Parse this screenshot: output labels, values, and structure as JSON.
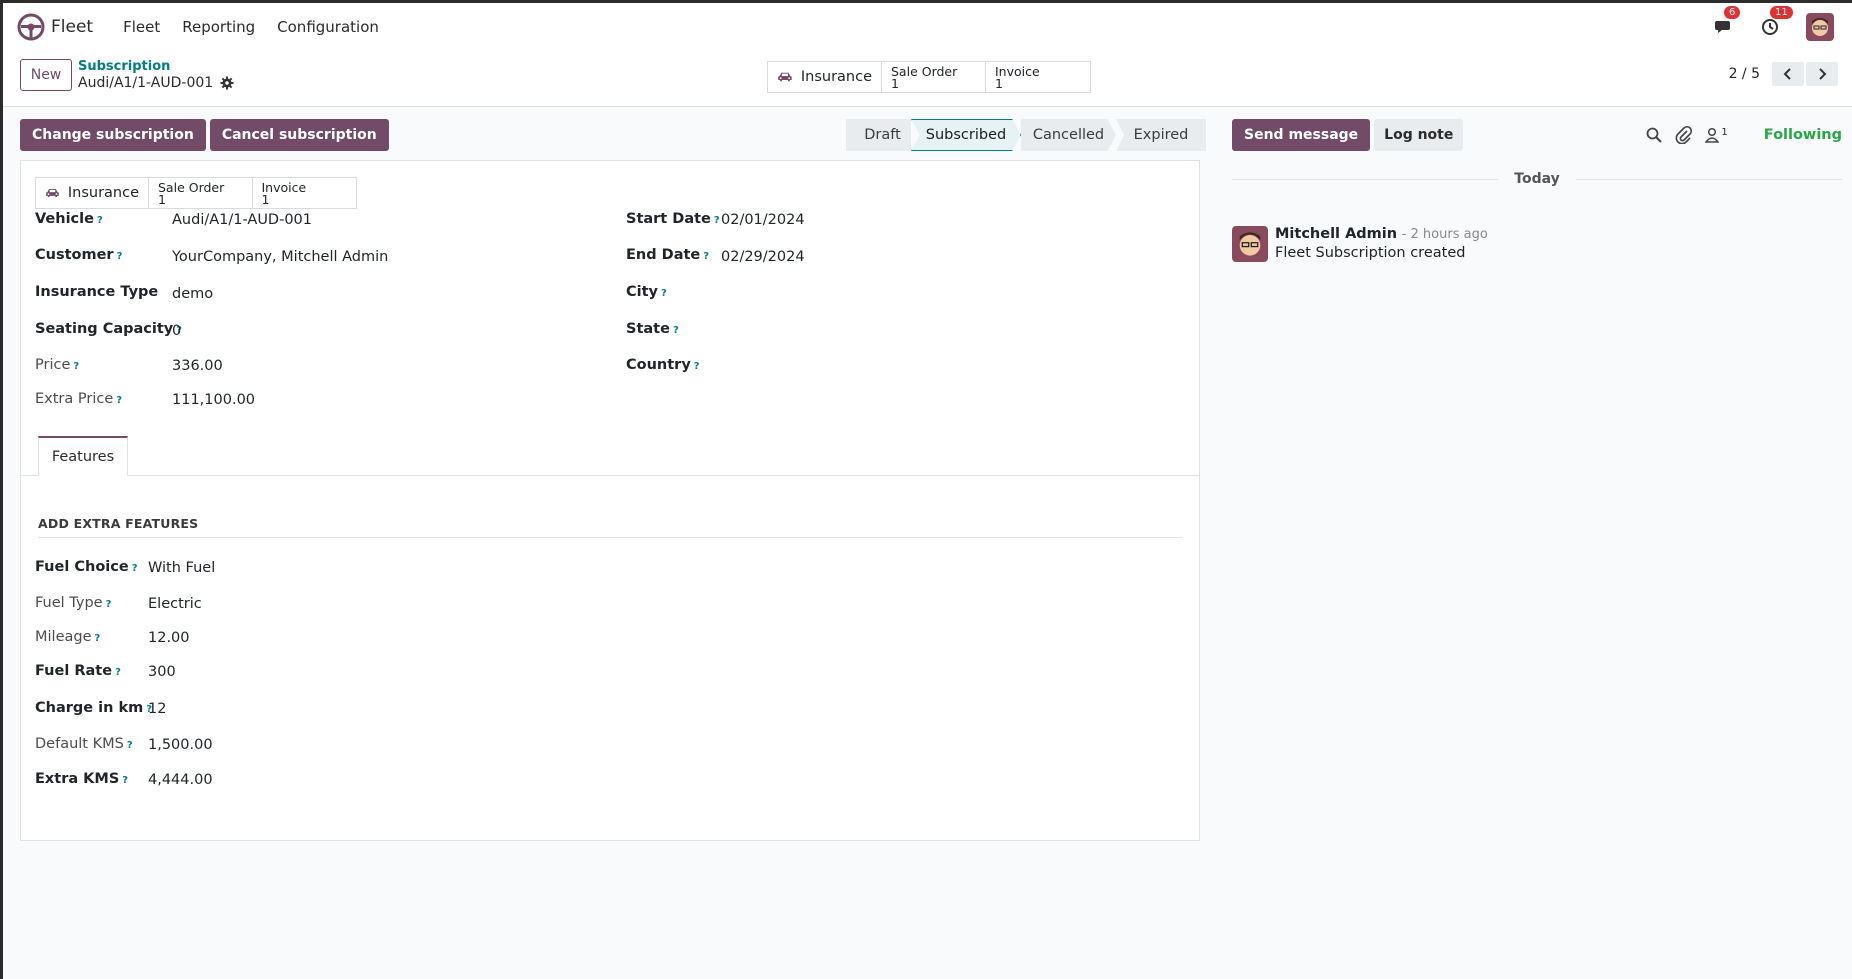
{
  "app": {
    "name": "Fleet"
  },
  "menu": [
    "Fleet",
    "Reporting",
    "Configuration"
  ],
  "systray": {
    "messages_count": "6",
    "activities_count": "11"
  },
  "control": {
    "new_label": "New",
    "breadcrumb_parent": "Subscription",
    "record_name": "Audi/A1/1-AUD-001",
    "pager": "2 / 5"
  },
  "smart_buttons": {
    "insurance_label": "Insurance",
    "sale_order_label": "Sale Order",
    "sale_order_count": "1",
    "invoice_label": "Invoice",
    "invoice_count": "1"
  },
  "actions": {
    "change": "Change subscription",
    "cancel": "Cancel subscription"
  },
  "stages": [
    "Draft",
    "Subscribed",
    "Cancelled",
    "Expired"
  ],
  "active_stage": "Subscribed",
  "form": {
    "left": [
      {
        "label": "Vehicle",
        "value": "Audi/A1/1-AUD-001"
      },
      {
        "label": "Customer",
        "value": "YourCompany, Mitchell Admin"
      },
      {
        "label": "Insurance Type",
        "value": "demo"
      },
      {
        "label": "Seating Capacity",
        "value": "0"
      },
      {
        "label": "Price",
        "value": "336.00"
      },
      {
        "label": "Extra Price",
        "value": "111,100.00"
      }
    ],
    "right": [
      {
        "label": "Start Date",
        "value": "02/01/2024"
      },
      {
        "label": "End Date",
        "value": "02/29/2024"
      },
      {
        "label": "City",
        "value": ""
      },
      {
        "label": "State",
        "value": ""
      },
      {
        "label": "Country",
        "value": ""
      }
    ]
  },
  "tab": {
    "label": "Features"
  },
  "features": {
    "section_title": "ADD EXTRA FEATURES",
    "rows": [
      {
        "label": "Fuel Choice",
        "value": "With Fuel"
      },
      {
        "label": "Fuel Type",
        "value": "Electric"
      },
      {
        "label": "Mileage",
        "value": "12.00"
      },
      {
        "label": "Fuel Rate",
        "value": "300"
      },
      {
        "label": "Charge in km",
        "value": "12"
      },
      {
        "label": "Default KMS",
        "value": "1,500.00"
      },
      {
        "label": "Extra KMS",
        "value": "4,444.00"
      }
    ]
  },
  "chatter": {
    "send_message": "Send message",
    "log_note": "Log note",
    "followers_count": "1",
    "following": "Following",
    "today": "Today",
    "message": {
      "author": "Mitchell Admin",
      "date": "- 2 hours ago",
      "text": "Fleet Subscription created"
    }
  },
  "colors": {
    "brand": "#714b67",
    "accent": "#017e84",
    "following": "#28a745",
    "badge": "#e03131"
  }
}
